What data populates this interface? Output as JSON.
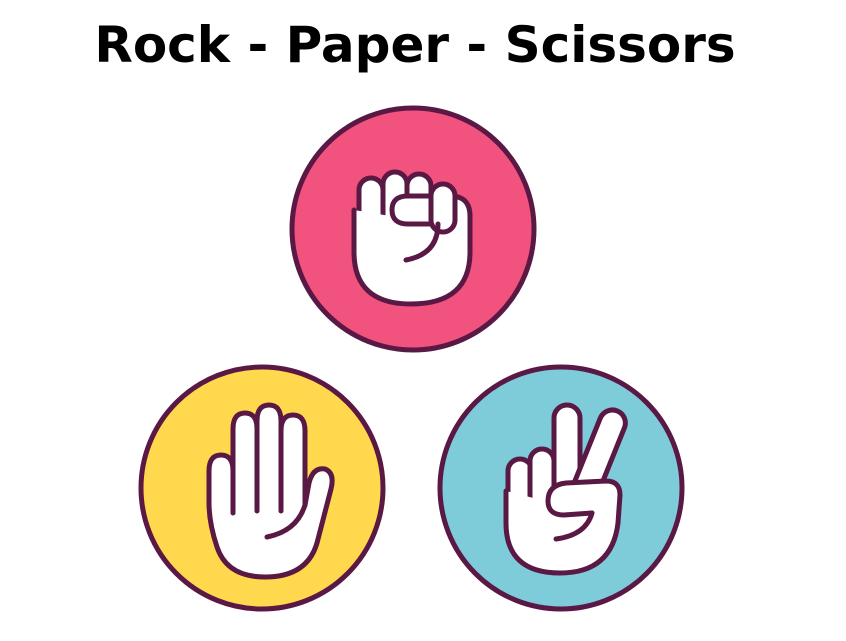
{
  "title": "Rock - Paper - Scissors",
  "choices": [
    {
      "id": "rock",
      "icon": "fist-icon",
      "color": "#F1527E"
    },
    {
      "id": "paper",
      "icon": "open-hand-icon",
      "color": "#FFD84E"
    },
    {
      "id": "scissors",
      "icon": "peace-hand-icon",
      "color": "#7ECCD9"
    }
  ],
  "colors": {
    "outline": "#5A1845",
    "hand": "#FFFFFF",
    "title": "#000000",
    "background": "#FFFFFF"
  }
}
